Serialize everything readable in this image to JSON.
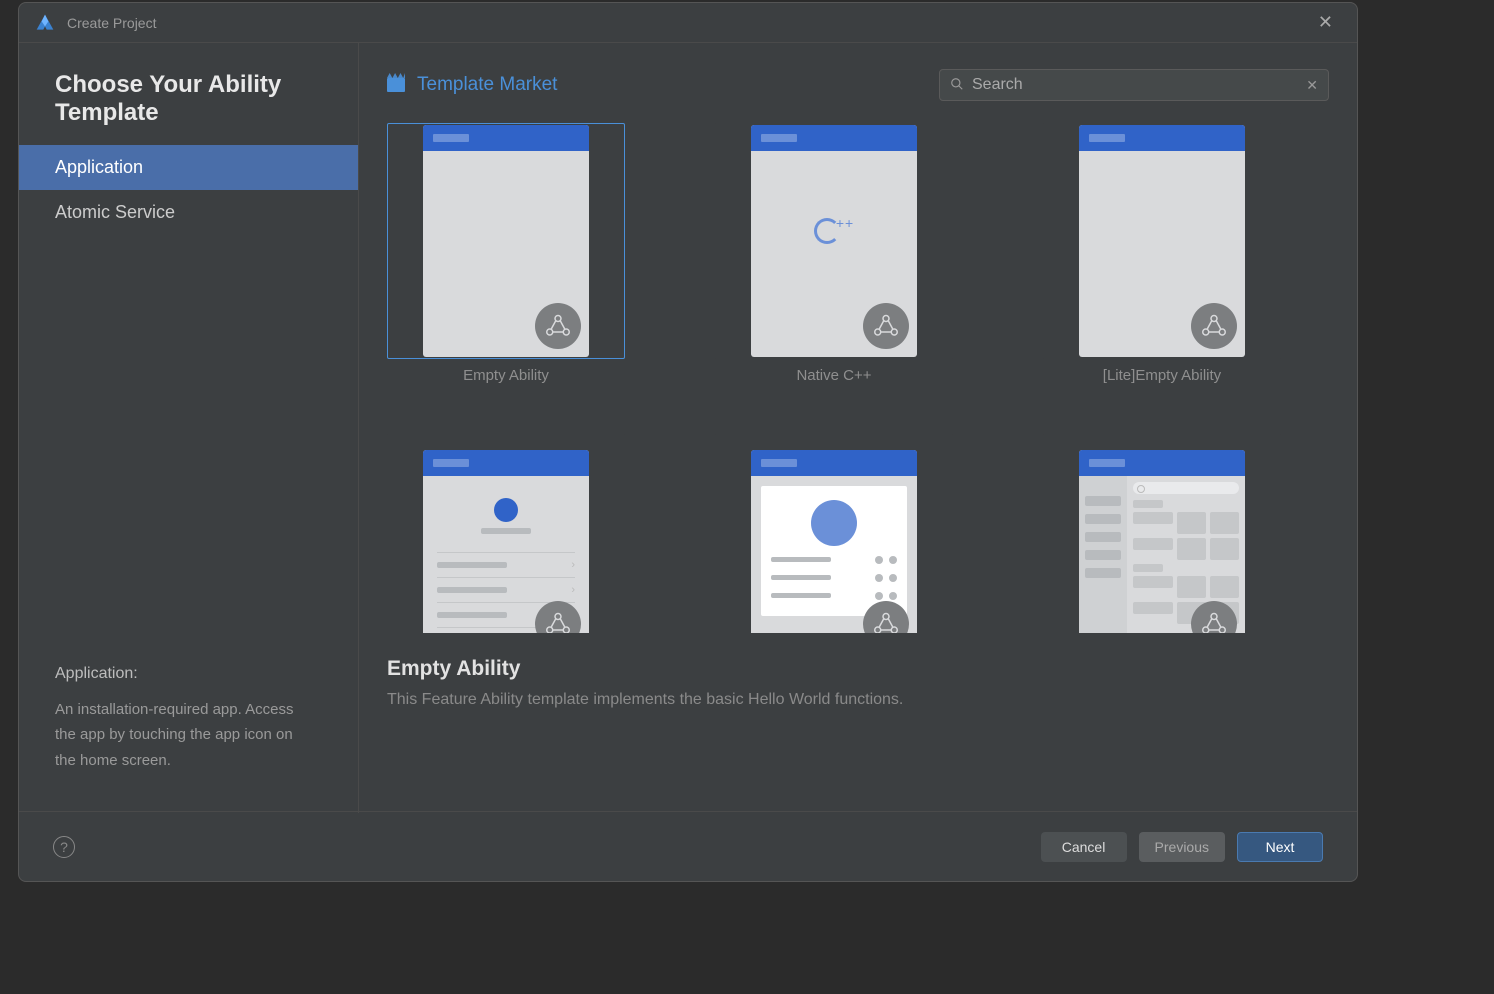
{
  "titlebar": {
    "title": "Create Project"
  },
  "sidebar": {
    "heading": "Choose Your Ability Template",
    "items": [
      {
        "label": "Application",
        "selected": true
      },
      {
        "label": "Atomic Service",
        "selected": false
      }
    ],
    "desc_title": "Application:",
    "desc_body": "An installation-required app. Access the app by touching the app icon on the home screen."
  },
  "main": {
    "template_market_label": "Template Market",
    "search_placeholder": "Search",
    "templates": [
      {
        "label": "Empty Ability",
        "kind": "empty",
        "selected": true
      },
      {
        "label": "Native C++",
        "kind": "cpp",
        "selected": false
      },
      {
        "label": "[Lite]Empty Ability",
        "kind": "empty",
        "selected": false
      },
      {
        "label": "",
        "kind": "list",
        "selected": false
      },
      {
        "label": "",
        "kind": "card",
        "selected": false
      },
      {
        "label": "",
        "kind": "grid",
        "selected": false
      }
    ],
    "detail_title": "Empty Ability",
    "detail_desc": "This Feature Ability template implements the basic Hello World functions."
  },
  "footer": {
    "cancel": "Cancel",
    "previous": "Previous",
    "next": "Next"
  }
}
